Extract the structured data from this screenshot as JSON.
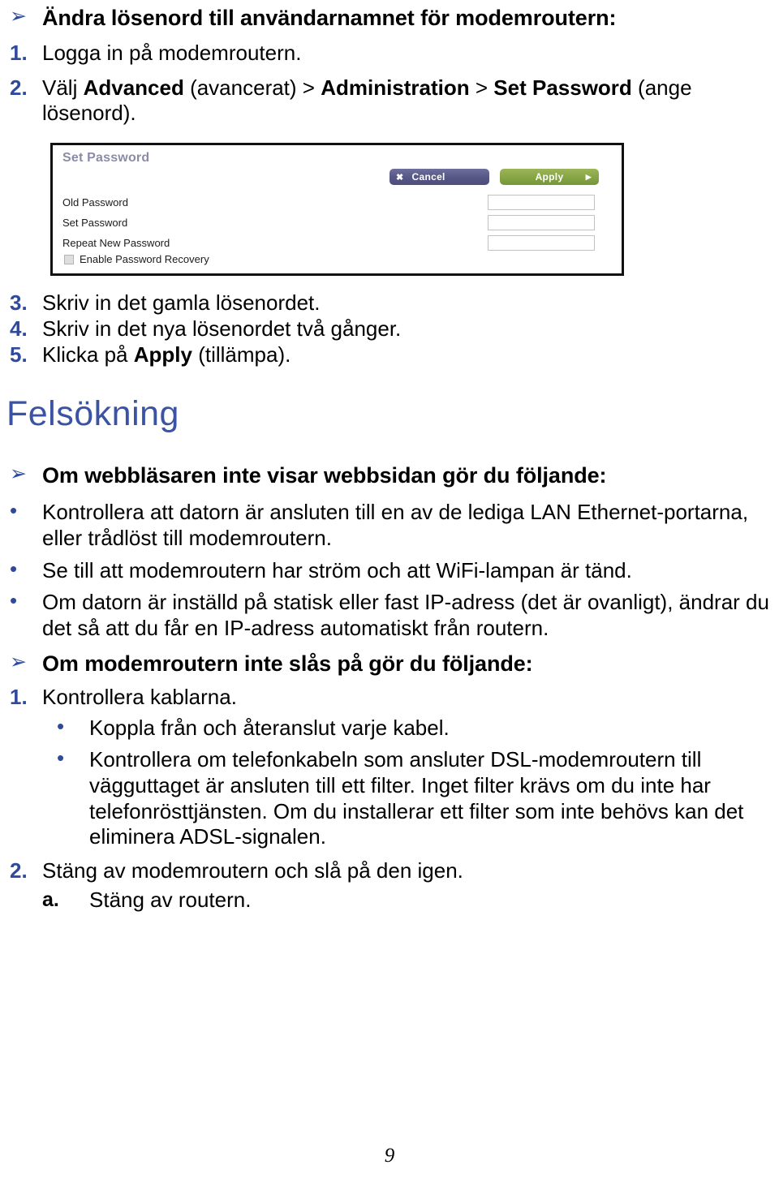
{
  "page": {
    "number": "9",
    "language": "sv"
  },
  "section_password": {
    "arrow_icon": "arrow-bullet-icon",
    "heading": "Ändra lösenord till användarnamnet för modemroutern:",
    "steps": [
      {
        "marker": "1.",
        "text": "Logga in på modemroutern."
      },
      {
        "marker": "2.",
        "text_pre": "Välj ",
        "bold_1": "Advanced",
        "text_mid_1": " (avancerat) > ",
        "bold_2": "Administration",
        "text_mid_2": " > ",
        "bold_3": "Set Password",
        "text_post": " (ange lösenord)."
      },
      {
        "marker": "3.",
        "text": "Skriv in det gamla lösenordet."
      },
      {
        "marker": "4.",
        "text": "Skriv in det nya lösenordet två gånger."
      },
      {
        "marker": "5.",
        "text_pre": "Klicka på ",
        "bold_1": "Apply",
        "text_post": " (tillämpa)."
      }
    ]
  },
  "figure_set_password": {
    "title": "Set Password",
    "cancel_button": {
      "label": "Cancel",
      "icon": "close-x-icon",
      "glyph": "✖",
      "color": "#565686"
    },
    "apply_button": {
      "label": "Apply",
      "icon": "play-arrow-icon",
      "glyph": "▶",
      "color": "#86a544"
    },
    "fields": [
      {
        "label": "Old Password",
        "value": ""
      },
      {
        "label": "Set Password",
        "value": ""
      },
      {
        "label": "Repeat New Password",
        "value": ""
      }
    ],
    "checkbox": {
      "label": "Enable Password Recovery",
      "checked": false
    }
  },
  "section_troubleshooting": {
    "heading": "Felsökning",
    "heading_color": "#3a53a4",
    "group_1": {
      "arrow_icon": "arrow-bullet-icon",
      "heading": "Om webbläsaren inte visar webbsidan gör du följande:",
      "bullets": [
        "Kontrollera att datorn är ansluten till en av de lediga LAN Ethernet-portarna, eller trådlöst till modemroutern.",
        "Se till att modemroutern har ström och att WiFi-lampan är tänd.",
        "Om datorn är inställd på statisk eller fast IP-adress (det är ovanligt), ändrar du det så att du får en IP-adress automatiskt från routern."
      ]
    },
    "group_2": {
      "arrow_icon": "arrow-bullet-icon",
      "heading": "Om modemroutern inte slås på gör du följande:",
      "items": [
        {
          "marker": "1.",
          "text": "Kontrollera kablarna.",
          "subbullets": [
            "Koppla från och återanslut varje kabel.",
            "Kontrollera om telefonkabeln som ansluter DSL-modemroutern till vägguttaget är ansluten till ett filter. Inget filter krävs om du inte har telefonrösttjänsten. Om du installerar ett filter som inte behövs kan det eliminera ADSL-signalen."
          ]
        },
        {
          "marker": "2.",
          "text": "Stäng av modemroutern och slå på den igen.",
          "subitems": [
            {
              "marker": "a.",
              "text": "Stäng av routern."
            }
          ]
        }
      ]
    }
  },
  "glyphs": {
    "arrow_bullet": "➢",
    "dot_bullet": "•"
  }
}
